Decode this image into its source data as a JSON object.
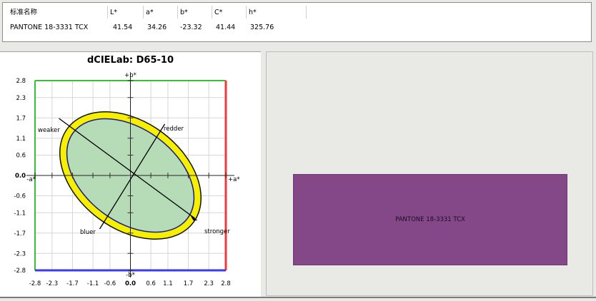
{
  "table": {
    "headers": [
      "标准名称",
      "L*",
      "a*",
      "b*",
      "C*",
      "h*"
    ],
    "row": [
      "PANTONE 18-3331 TCX",
      "41.54",
      "34.26",
      "-23.32",
      "41.44",
      "325.76"
    ]
  },
  "chart": {
    "title": "dCIELab: D65-10",
    "axis_labels": {
      "pos_b": "+b*",
      "neg_b": "-b*",
      "pos_a": "+a*",
      "neg_a": "-a*"
    },
    "x_ticks": [
      "-2.8",
      "-2.3",
      "-1.7",
      "-1.1",
      "-0.6",
      "0.0",
      "0.6",
      "1.1",
      "1.7",
      "2.3",
      "2.8"
    ],
    "y_ticks": [
      "2.8",
      "2.3",
      "1.7",
      "1.1",
      "0.6",
      "0.0",
      "-0.6",
      "-1.1",
      "-1.7",
      "-2.3",
      "-2.8"
    ],
    "directions": {
      "weaker": "weaker",
      "redder": "redder",
      "bluer": "bluer",
      "stronger": "stronger"
    }
  },
  "chart_data": {
    "type": "scatter",
    "title": "dCIELab: D65-10",
    "xlabel": "a*",
    "ylabel": "b*",
    "xlim": [
      -2.8,
      2.8
    ],
    "ylim": [
      -2.8,
      2.8
    ],
    "x_ticks": [
      -2.8,
      -2.3,
      -1.7,
      -1.1,
      -0.6,
      0.0,
      0.6,
      1.1,
      1.7,
      2.3,
      2.8
    ],
    "y_ticks": [
      -2.8,
      -2.3,
      -1.7,
      -1.1,
      -0.6,
      0.0,
      0.6,
      1.1,
      1.7,
      2.3,
      2.8
    ],
    "grid": true,
    "annotations": [
      "weaker",
      "redder",
      "bluer",
      "stronger"
    ]
  },
  "swatch": {
    "label": "PANTONE 18-3331 TCX",
    "color": "#844888"
  },
  "colors": {
    "ellipse_inner": "#b5dcb6",
    "ellipse_ring": "#f6f000",
    "ellipse_outline": "#1a1a8a",
    "axis_red": "#f03a3a",
    "axis_green": "#35c035",
    "axis_blue": "#3a3af0"
  }
}
